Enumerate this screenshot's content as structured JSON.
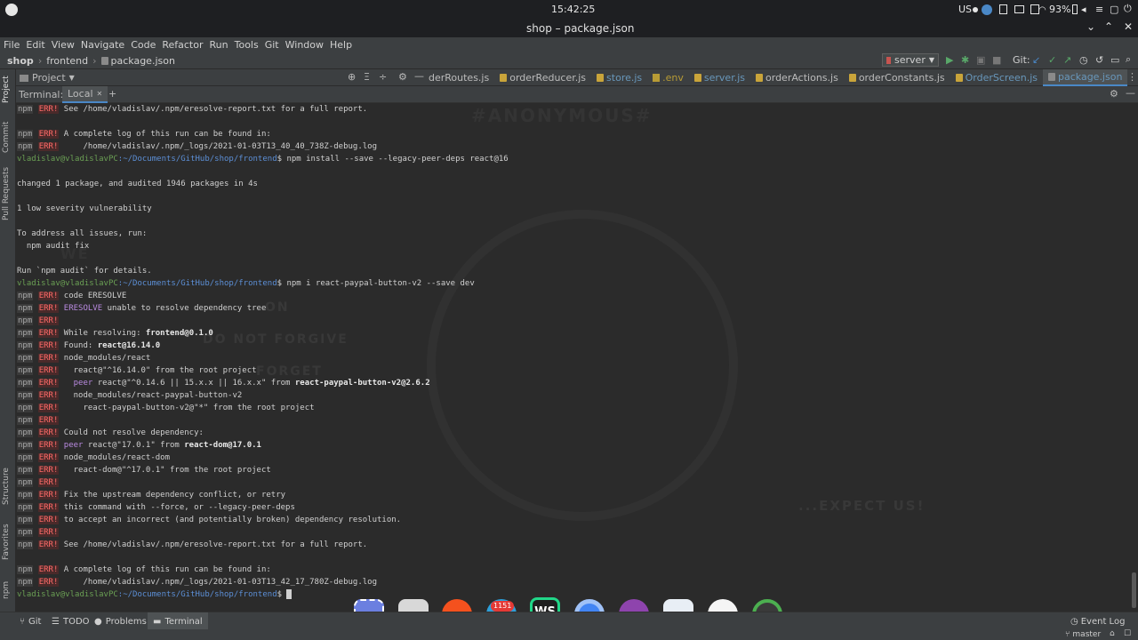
{
  "system": {
    "time": "15:42:25",
    "keyboard": "US",
    "battery": "93%"
  },
  "window": {
    "title": "shop – package.json"
  },
  "menu": [
    "File",
    "Edit",
    "View",
    "Navigate",
    "Code",
    "Refactor",
    "Run",
    "Tools",
    "Git",
    "Window",
    "Help"
  ],
  "breadcrumb": [
    "shop",
    "frontend",
    "package.json"
  ],
  "run_config": "server",
  "git_label": "Git:",
  "project_panel": "Project",
  "tabs": [
    {
      "label": "derRoutes.js",
      "type": "js"
    },
    {
      "label": "orderReducer.js",
      "type": "js"
    },
    {
      "label": "store.js",
      "type": "js"
    },
    {
      "label": ".env",
      "type": "env"
    },
    {
      "label": "server.js",
      "type": "js"
    },
    {
      "label": "orderActions.js",
      "type": "js"
    },
    {
      "label": "orderConstants.js",
      "type": "js"
    },
    {
      "label": "OrderScreen.js",
      "type": "js"
    },
    {
      "label": "package.json",
      "type": "json",
      "active": true
    }
  ],
  "terminal": {
    "label": "Terminal:",
    "tab": "Local",
    "lines": [
      {
        "p": "npm ERR!",
        "t": " See /home/vladislav/.npm/eresolve-report.txt for a full report."
      },
      {
        "t": ""
      },
      {
        "p": "npm ERR!",
        "t": " A complete log of this run can be found in:"
      },
      {
        "p": "npm ERR!",
        "t": "     /home/vladislav/.npm/_logs/2021-01-03T13_40_40_738Z-debug.log"
      },
      {
        "prompt": "vladislav@vladislavPC",
        "path": ":~/Documents/GitHub/shop/frontend",
        "t": "$ npm install --save --legacy-peer-deps react@16"
      },
      {
        "t": ""
      },
      {
        "t": "changed 1 package, and audited 1946 packages in 4s"
      },
      {
        "t": ""
      },
      {
        "t": "1 low severity vulnerability"
      },
      {
        "t": ""
      },
      {
        "t": "To address all issues, run:"
      },
      {
        "t": "  npm audit fix"
      },
      {
        "t": ""
      },
      {
        "t": "Run `npm audit` for details."
      },
      {
        "prompt": "vladislav@vladislavPC",
        "path": ":~/Documents/GitHub/shop/frontend",
        "t": "$ npm i react-paypal-button-v2 --save dev"
      },
      {
        "p": "npm ERR!",
        "t": " code ERESOLVE"
      },
      {
        "p": "npm ERR!",
        "e": " ERESOLVE",
        "t": " unable to resolve dependency tree"
      },
      {
        "p": "npm ERR!",
        "t": ""
      },
      {
        "p": "npm ERR!",
        "t": " While resolving: ",
        "b": "frontend@0.1.0"
      },
      {
        "p": "npm ERR!",
        "t": " Found: ",
        "b": "react@16.14.0"
      },
      {
        "p": "npm ERR!",
        "t": " node_modules/react"
      },
      {
        "p": "npm ERR!",
        "t": "   react@\"^16.14.0\" from the root project"
      },
      {
        "p": "npm ERR!",
        "e": "   peer",
        "t": " react@\"^0.14.6 || 15.x.x || 16.x.x\" from ",
        "b": "react-paypal-button-v2@2.6.2"
      },
      {
        "p": "npm ERR!",
        "t": "   node_modules/react-paypal-button-v2"
      },
      {
        "p": "npm ERR!",
        "t": "     react-paypal-button-v2@\"*\" from the root project"
      },
      {
        "p": "npm ERR!",
        "t": ""
      },
      {
        "p": "npm ERR!",
        "t": " Could not resolve dependency:"
      },
      {
        "p": "npm ERR!",
        "e": " peer",
        "t": " react@\"17.0.1\" from ",
        "b": "react-dom@17.0.1"
      },
      {
        "p": "npm ERR!",
        "t": " node_modules/react-dom"
      },
      {
        "p": "npm ERR!",
        "t": "   react-dom@\"^17.0.1\" from the root project"
      },
      {
        "p": "npm ERR!",
        "t": ""
      },
      {
        "p": "npm ERR!",
        "t": " Fix the upstream dependency conflict, or retry"
      },
      {
        "p": "npm ERR!",
        "t": " this command with --force, or --legacy-peer-deps"
      },
      {
        "p": "npm ERR!",
        "t": " to accept an incorrect (and potentially broken) dependency resolution."
      },
      {
        "p": "npm ERR!",
        "t": ""
      },
      {
        "p": "npm ERR!",
        "t": " See /home/vladislav/.npm/eresolve-report.txt for a full report."
      },
      {
        "t": ""
      },
      {
        "p": "npm ERR!",
        "t": " A complete log of this run can be found in:"
      },
      {
        "p": "npm ERR!",
        "t": "     /home/vladislav/.npm/_logs/2021-01-03T13_42_17_780Z-debug.log"
      },
      {
        "prompt": "vladislav@vladislavPC",
        "path": ":~/Documents/GitHub/shop/frontend",
        "t": "$ ",
        "cursor": true
      }
    ]
  },
  "wallpaper_text": {
    "top": "#ANONYMOUS#",
    "mid1": "WE",
    "mid2": "ON",
    "mid3": "DO NOT FORGIVE",
    "mid4": "FORGET",
    "bottom": "...EXPECT US!"
  },
  "left_tools": [
    "Project",
    "Commit",
    "Pull Requests",
    "Structure",
    "Favorites",
    "npm"
  ],
  "bottom_tools": [
    "Git",
    "TODO",
    "Problems",
    "Terminal"
  ],
  "event_log": "Event Log",
  "branch": "master",
  "dock_badge": "1151",
  "colors": {
    "accent": "#4a88c7",
    "error": "#ff6b68",
    "prompt": "#6a9f54",
    "path": "#5c8fd6"
  }
}
